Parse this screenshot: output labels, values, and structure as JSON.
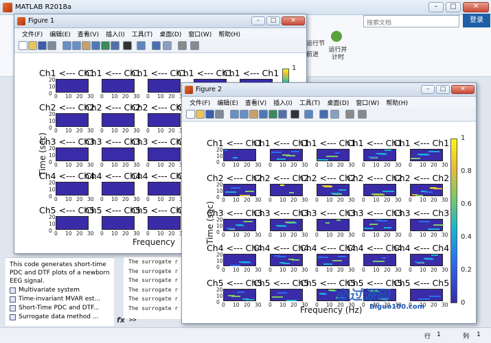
{
  "app": {
    "title": "MATLAB R2018a",
    "search_placeholder": "搜索文档",
    "login": "登录"
  },
  "ribbon": {
    "run_section": "运行节",
    "advance": "前进",
    "run_and_time": "运行并\n计时"
  },
  "figure_menu": [
    "文件(F)",
    "编辑(E)",
    "查看(V)",
    "插入(I)",
    "工具(T)",
    "桌面(D)",
    "窗口(W)",
    "帮助(H)"
  ],
  "figure1": {
    "title": "Figure 1",
    "row_titles": [
      "Ch1 <--- Ch1",
      "Ch2 <--- Ch2",
      "Ch3 <--- Ch3",
      "Ch4 <--- Ch4",
      "Ch5 <--- Ch5"
    ],
    "y_ticks": [
      "20",
      "10",
      "0"
    ],
    "x_ticks": [
      "0",
      "10",
      "20",
      "30"
    ],
    "ylabel": "Time (sec)",
    "xlabel": "Frequency",
    "colorbar_tick": "1"
  },
  "figure2": {
    "title": "Figure 2",
    "row_titles": [
      "Ch1 <--- Ch1",
      "Ch2 <--- Ch2",
      "Ch3 <--- Ch3",
      "Ch4 <--- Ch4",
      "Ch5 <--- Ch5"
    ],
    "y_ticks": [
      "20",
      "10",
      "0"
    ],
    "x_ticks": [
      "0",
      "10",
      "20",
      "30"
    ],
    "ylabel": "Time (sec)",
    "xlabel": "Frequency (Hz)",
    "colorbar_ticks": [
      "1",
      "0.8",
      "0.6",
      "0.4",
      "0.2",
      "0"
    ]
  },
  "left_panel": {
    "description": "This code generates short-time PDC and DTF plots of a newborn EEG signal.",
    "items": [
      "Multivariate system",
      "Time-invariant MVAR est...",
      "Short-Time PDC and DTF...",
      "Surrogate data method ..."
    ]
  },
  "command_window": {
    "lines": [
      "The surrogate r",
      "The surrogate r",
      "The surrogate r",
      "The surrogate r",
      "The surrogate r",
      "The surrogate r",
      "The surrogate r"
    ],
    "prompt": ">>"
  },
  "status": {
    "row_label": "行",
    "row_value": "1",
    "col_label": "列",
    "col_value": "1"
  },
  "watermark": {
    "main": "必过源码",
    "sub": "Biguo100.com"
  },
  "colors": {
    "plot_base": "#3a2ca8",
    "accent": "#1e5fa8"
  }
}
